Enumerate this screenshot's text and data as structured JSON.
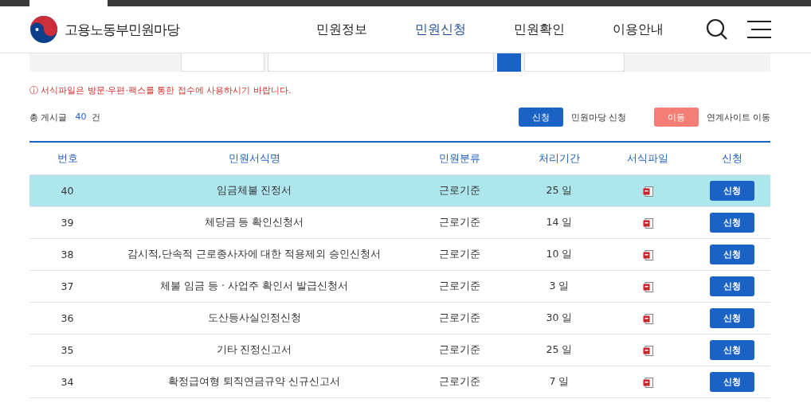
{
  "header": {
    "logo_text": "고용노동부민원마당",
    "nav": [
      {
        "label": "민원정보",
        "selected": false
      },
      {
        "label": "민원신청",
        "selected": true
      },
      {
        "label": "민원확인",
        "selected": false
      },
      {
        "label": "이용안내",
        "selected": false
      }
    ]
  },
  "notice": {
    "icon": "ⓘ",
    "text": "서식파일은 방문·우편·팩스를 통한 접수에 사용하시기 바랍니다."
  },
  "summary": {
    "label": "총 게시글",
    "count": "40",
    "unit": "건"
  },
  "legend": [
    {
      "badge": "신청",
      "text": "민원마당 신청",
      "color": "#1a63c5"
    },
    {
      "badge": "이동",
      "text": "연계사이트 이동",
      "color": "#f47d76"
    }
  ],
  "table": {
    "columns": [
      "번호",
      "민원서식명",
      "민원분류",
      "처리기간",
      "서식파일",
      "신청"
    ],
    "rows": [
      {
        "no": "40",
        "name": "임금체불 진정서",
        "category": "근로기준",
        "period": "25 일",
        "button": "신청",
        "selected": true
      },
      {
        "no": "39",
        "name": "체당금 등 확인신청서",
        "category": "근로기준",
        "period": "14 일",
        "button": "신청",
        "selected": false
      },
      {
        "no": "38",
        "name": "감시적,단속적 근로종사자에 대한 적용제외 승인신청서",
        "category": "근로기준",
        "period": "10 일",
        "button": "신청",
        "selected": false
      },
      {
        "no": "37",
        "name": "체불 임금 등 · 사업주 확인서 발급신청서",
        "category": "근로기준",
        "period": "3 일",
        "button": "신청",
        "selected": false
      },
      {
        "no": "36",
        "name": "도산등사실인정신청",
        "category": "근로기준",
        "period": "30 일",
        "button": "신청",
        "selected": false
      },
      {
        "no": "35",
        "name": "기타 진정신고서",
        "category": "근로기준",
        "period": "25 일",
        "button": "신청",
        "selected": false
      },
      {
        "no": "34",
        "name": "확정급여형 퇴직연금규약 신규신고서",
        "category": "근로기준",
        "period": "7 일",
        "button": "신청",
        "selected": false
      }
    ]
  }
}
